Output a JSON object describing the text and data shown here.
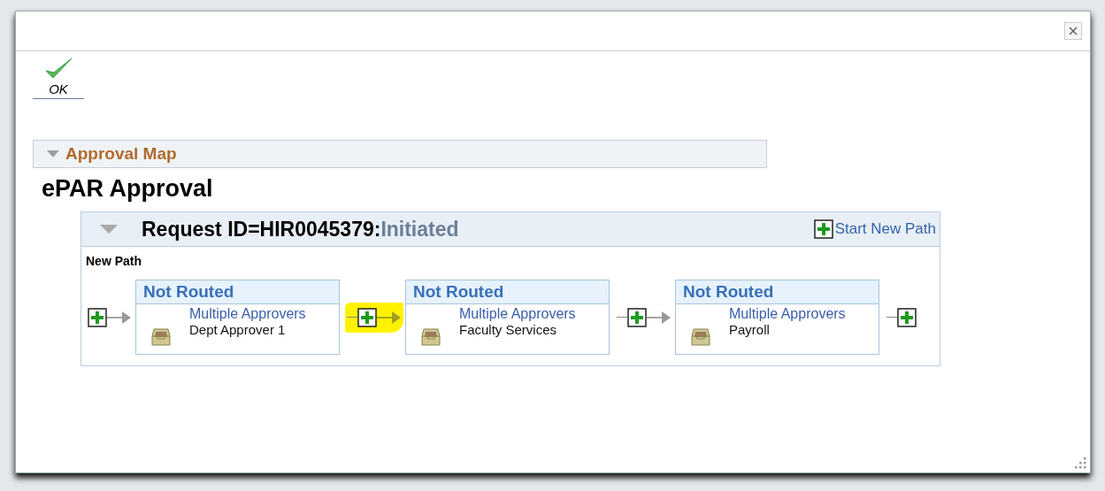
{
  "toolbar": {
    "ok_label": "OK"
  },
  "section": {
    "title": "Approval Map",
    "expanded": true
  },
  "heading": "ePAR Approval",
  "request": {
    "expanded": true,
    "label": "Request ID=HIR0045379:",
    "status": "Initiated",
    "start_new_path": "Start New Path",
    "path_label": "New Path",
    "connectors": [
      {
        "highlighted": false
      },
      {
        "highlighted": true
      },
      {
        "highlighted": false
      },
      {
        "highlighted": false
      }
    ],
    "steps": [
      {
        "status": "Not Routed",
        "approver_type": "Multiple Approvers",
        "approver": "Dept Approver 1"
      },
      {
        "status": "Not Routed",
        "approver_type": "Multiple Approvers",
        "approver": "Faculty Services"
      },
      {
        "status": "Not Routed",
        "approver_type": "Multiple Approvers",
        "approver": "Payroll"
      }
    ]
  }
}
